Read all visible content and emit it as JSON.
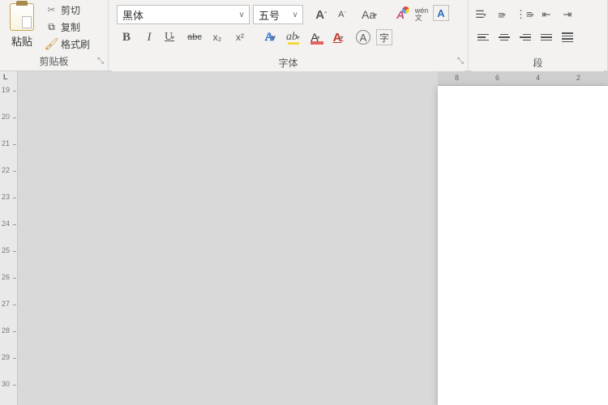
{
  "clipboard": {
    "title": "剪贴板",
    "paste": "粘贴",
    "cut": "剪切",
    "copy": "复制",
    "format_painter": "格式刷"
  },
  "font": {
    "title": "字体",
    "family": "黑体",
    "size": "五号",
    "grow": "A",
    "shrink": "A",
    "change_case": "Aa",
    "clear_format": "A",
    "phonetic": "wén",
    "char_border": "A",
    "bold": "B",
    "italic": "I",
    "underline": "U",
    "strike": "abc",
    "subscript": "x₂",
    "superscript": "x²",
    "texteffect": "A",
    "texteffect2": "ab",
    "highlight": "A",
    "fontcolor": "A",
    "circled": "A",
    "emphasis": "字"
  },
  "paragraph": {
    "title": "段"
  },
  "hruler": {
    "n8": "8",
    "n6": "6",
    "n4": "4",
    "n2": "2"
  },
  "vruler": {
    "label": "L",
    "marks": [
      "19",
      "20",
      "21",
      "22",
      "23",
      "24",
      "25",
      "26",
      "27",
      "28",
      "29",
      "30"
    ]
  },
  "icons": {
    "dropdown": "∨",
    "dd_small": "▾",
    "launcher": "⤡"
  }
}
